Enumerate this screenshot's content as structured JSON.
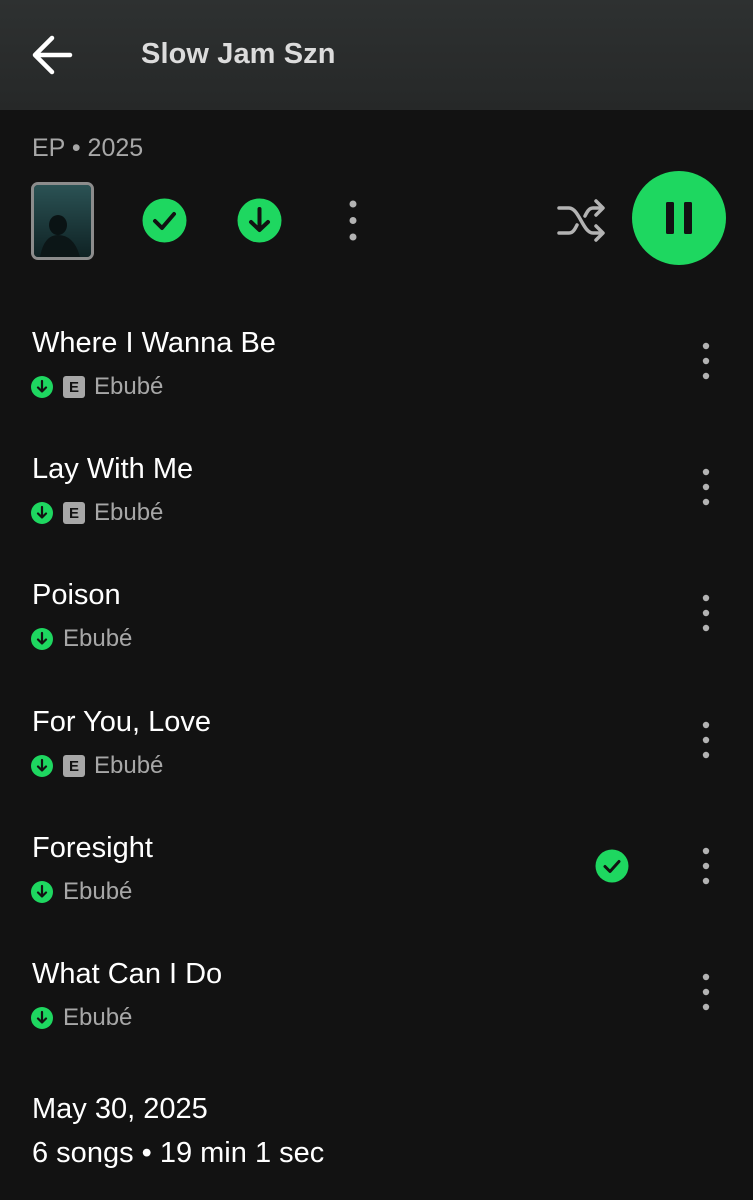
{
  "header": {
    "title": "Slow Jam Szn"
  },
  "album": {
    "meta": "EP • 2025"
  },
  "actions": {
    "saved_icon": "check-circle-icon",
    "download_icon": "download-circle-icon",
    "more_icon": "more-vertical-icon",
    "shuffle_icon": "shuffle-icon",
    "play_state_icon": "pause-icon"
  },
  "tracks": [
    {
      "title": "Where I Wanna Be",
      "artist": "Ebubé",
      "explicit": true,
      "explicit_label": "E",
      "downloaded": true,
      "added": false
    },
    {
      "title": "Lay With Me",
      "artist": "Ebubé",
      "explicit": true,
      "explicit_label": "E",
      "downloaded": true,
      "added": false
    },
    {
      "title": "Poison",
      "artist": "Ebubé",
      "explicit": false,
      "downloaded": true,
      "added": false
    },
    {
      "title": "For You, Love",
      "artist": "Ebubé",
      "explicit": true,
      "explicit_label": "E",
      "downloaded": true,
      "added": false
    },
    {
      "title": "Foresight",
      "artist": "Ebubé",
      "explicit": false,
      "downloaded": true,
      "added": true
    },
    {
      "title": "What Can I Do",
      "artist": "Ebubé",
      "explicit": false,
      "downloaded": true,
      "added": false
    }
  ],
  "footer": {
    "release_date": "May 30, 2025",
    "summary": "6 songs • 19 min 1 sec"
  },
  "colors": {
    "accent": "#1ed760",
    "background": "#121212",
    "header_bg": "#2a2d2d",
    "secondary_text": "#a7a7a7"
  }
}
